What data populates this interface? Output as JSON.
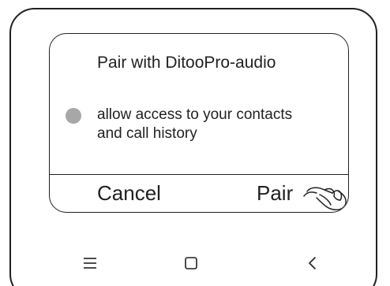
{
  "dialog": {
    "title": "Pair with DitooPro-audio",
    "permission_line1": "allow access to your contacts",
    "permission_line2": "and call history",
    "cancel_label": "Cancel",
    "pair_label": "Pair"
  },
  "colors": {
    "outline": "#231f20",
    "toggle_dot": "#a7a7a7",
    "background": "#ffffff"
  },
  "icons": {
    "pointer": "hand-pointer-icon",
    "nav_menu": "menu-icon",
    "nav_home": "home-square-icon",
    "nav_back": "back-chevron-icon"
  }
}
